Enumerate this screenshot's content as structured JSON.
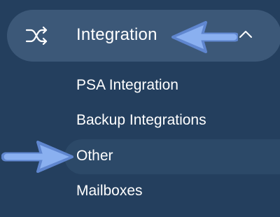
{
  "menu": {
    "parent": {
      "label": "Integration",
      "icon": "shuffle-icon",
      "expanded": true,
      "toggle_icon": "chevron-up-icon"
    },
    "children": [
      {
        "label": "PSA Integration"
      },
      {
        "label": "Backup Integrations"
      },
      {
        "label": "Other",
        "active": true
      },
      {
        "label": "Mailboxes"
      }
    ]
  },
  "annotations": [
    {
      "icon": "arrow-left-icon",
      "color": "#8ab0f0"
    },
    {
      "icon": "arrow-right-icon",
      "color": "#8ab0f0"
    }
  ],
  "colors": {
    "background": "#243f5e",
    "active_parent": "#3c5878",
    "active_child": "#2c4968",
    "arrow": "#8ab0f0",
    "text": "#ffffff"
  }
}
